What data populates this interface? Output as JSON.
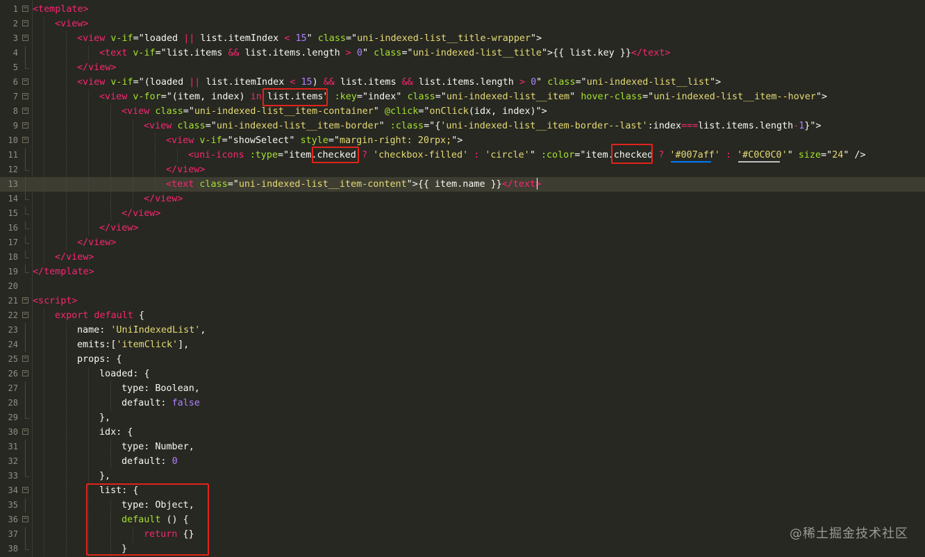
{
  "lines": [
    {
      "n": "1",
      "fold": "box",
      "indent": 0,
      "tokens": [
        [
          "t",
          "<template>"
        ]
      ]
    },
    {
      "n": "2",
      "fold": "box",
      "indent": 1,
      "tokens": [
        [
          "t",
          "<view>"
        ]
      ]
    },
    {
      "n": "3",
      "fold": "box",
      "indent": 2,
      "tokens": [
        [
          "t",
          "<view "
        ],
        [
          "a",
          "v-if"
        ],
        [
          "p",
          "=\""
        ],
        [
          "p",
          "loaded "
        ],
        [
          "t",
          "||"
        ],
        [
          "p",
          " list.itemIndex "
        ],
        [
          "t",
          "<"
        ],
        [
          "p",
          " "
        ],
        [
          "n",
          "15"
        ],
        [
          "p",
          "\" "
        ],
        [
          "a",
          "class"
        ],
        [
          "p",
          "=\""
        ],
        [
          "s",
          "uni-indexed-list__title-wrapper"
        ],
        [
          "p",
          "\">"
        ]
      ]
    },
    {
      "n": "4",
      "fold": "line",
      "indent": 3,
      "tokens": [
        [
          "t",
          "<text "
        ],
        [
          "a",
          "v-if"
        ],
        [
          "p",
          "=\"list.items "
        ],
        [
          "t",
          "&&"
        ],
        [
          "p",
          " list.items.length "
        ],
        [
          "t",
          ">"
        ],
        [
          "p",
          " "
        ],
        [
          "n",
          "0"
        ],
        [
          "p",
          "\" "
        ],
        [
          "a",
          "class"
        ],
        [
          "p",
          "=\""
        ],
        [
          "s",
          "uni-indexed-list__title"
        ],
        [
          "p",
          "\">{{ list.key }}"
        ],
        [
          "t",
          "</text>"
        ]
      ]
    },
    {
      "n": "5",
      "fold": "end",
      "indent": 2,
      "tokens": [
        [
          "t",
          "</view>"
        ]
      ]
    },
    {
      "n": "6",
      "fold": "box",
      "indent": 2,
      "tokens": [
        [
          "t",
          "<view "
        ],
        [
          "a",
          "v-if"
        ],
        [
          "p",
          "=\"(loaded "
        ],
        [
          "t",
          "||"
        ],
        [
          "p",
          " list.itemIndex "
        ],
        [
          "t",
          "<"
        ],
        [
          "p",
          " "
        ],
        [
          "n",
          "15"
        ],
        [
          "p",
          ") "
        ],
        [
          "t",
          "&&"
        ],
        [
          "p",
          " list.items "
        ],
        [
          "t",
          "&&"
        ],
        [
          "p",
          " list.items.length "
        ],
        [
          "t",
          ">"
        ],
        [
          "p",
          " "
        ],
        [
          "n",
          "0"
        ],
        [
          "p",
          "\" "
        ],
        [
          "a",
          "class"
        ],
        [
          "p",
          "=\""
        ],
        [
          "s",
          "uni-indexed-list__list"
        ],
        [
          "p",
          "\">"
        ]
      ]
    },
    {
      "n": "7",
      "fold": "box",
      "indent": 3,
      "tokens": [
        [
          "t",
          "<view "
        ],
        [
          "a",
          "v-for"
        ],
        [
          "p",
          "=\"(item, index) "
        ],
        [
          "t",
          "in"
        ],
        [
          "p",
          " list.items\" "
        ],
        [
          "a",
          ":key"
        ],
        [
          "p",
          "=\"index\" "
        ],
        [
          "a",
          "class"
        ],
        [
          "p",
          "=\""
        ],
        [
          "s",
          "uni-indexed-list__item"
        ],
        [
          "p",
          "\" "
        ],
        [
          "a",
          "hover-class"
        ],
        [
          "p",
          "=\""
        ],
        [
          "s",
          "uni-indexed-list__item--hover"
        ],
        [
          "p",
          "\">"
        ]
      ]
    },
    {
      "n": "8",
      "fold": "box",
      "indent": 4,
      "tokens": [
        [
          "t",
          "<view "
        ],
        [
          "a",
          "class"
        ],
        [
          "p",
          "=\""
        ],
        [
          "s",
          "uni-indexed-list__item-container"
        ],
        [
          "p",
          "\" "
        ],
        [
          "a",
          "@click"
        ],
        [
          "p",
          "=\""
        ],
        [
          "s",
          "onClick"
        ],
        [
          "p",
          "(idx, index)\">"
        ]
      ]
    },
    {
      "n": "9",
      "fold": "box",
      "indent": 5,
      "tokens": [
        [
          "t",
          "<view "
        ],
        [
          "a",
          "class"
        ],
        [
          "p",
          "=\""
        ],
        [
          "s",
          "uni-indexed-list__item-border"
        ],
        [
          "p",
          "\" "
        ],
        [
          "a",
          ":class"
        ],
        [
          "p",
          "=\"{"
        ],
        [
          "s",
          "'uni-indexed-list__item-border--last'"
        ],
        [
          "p",
          ":index"
        ],
        [
          "t",
          "==="
        ],
        [
          "p",
          "list.items.length"
        ],
        [
          "t",
          "-"
        ],
        [
          "n",
          "1"
        ],
        [
          "p",
          "}\">"
        ]
      ]
    },
    {
      "n": "10",
      "fold": "box",
      "indent": 6,
      "tokens": [
        [
          "t",
          "<view "
        ],
        [
          "a",
          "v-if"
        ],
        [
          "p",
          "=\"showSelect\" "
        ],
        [
          "a",
          "style"
        ],
        [
          "p",
          "=\""
        ],
        [
          "s",
          "margin-right: 20rpx;"
        ],
        [
          "p",
          "\">"
        ]
      ]
    },
    {
      "n": "11",
      "fold": "line",
      "indent": 7,
      "tokens": [
        [
          "t",
          "<uni-icons "
        ],
        [
          "a",
          ":type"
        ],
        [
          "p",
          "=\"item."
        ],
        [
          "p",
          "checked"
        ],
        [
          "p",
          " "
        ],
        [
          "t",
          "?"
        ],
        [
          "p",
          " "
        ],
        [
          "s",
          "'checkbox-filled'"
        ],
        [
          "p",
          " "
        ],
        [
          "t",
          ":"
        ],
        [
          "p",
          " "
        ],
        [
          "s",
          "'circle'"
        ],
        [
          "p",
          "\" "
        ],
        [
          "a",
          ":color"
        ],
        [
          "p",
          "=\"item."
        ],
        [
          "p",
          "checked"
        ],
        [
          "p",
          " "
        ],
        [
          "t",
          "?"
        ],
        [
          "p",
          " "
        ],
        [
          "s",
          "'#007aff'"
        ],
        [
          "p",
          " "
        ],
        [
          "t",
          ":"
        ],
        [
          "p",
          " "
        ],
        [
          "s",
          "'#C0C0C0'"
        ],
        [
          "p",
          "\" "
        ],
        [
          "a",
          "size"
        ],
        [
          "p",
          "=\""
        ],
        [
          "s",
          "24"
        ],
        [
          "p",
          "\" />"
        ]
      ]
    },
    {
      "n": "12",
      "fold": "end",
      "indent": 6,
      "tokens": [
        [
          "t",
          "</view>"
        ]
      ]
    },
    {
      "n": "13",
      "fold": "line",
      "indent": 6,
      "current": true,
      "tokens": [
        [
          "t",
          "<text "
        ],
        [
          "a",
          "class"
        ],
        [
          "p",
          "=\""
        ],
        [
          "s",
          "uni-indexed-list__item-content"
        ],
        [
          "p",
          "\">{{ item.name }}"
        ],
        [
          "t",
          "</text>"
        ]
      ]
    },
    {
      "n": "14",
      "fold": "end",
      "indent": 5,
      "tokens": [
        [
          "t",
          "</view>"
        ]
      ]
    },
    {
      "n": "15",
      "fold": "end",
      "indent": 4,
      "tokens": [
        [
          "t",
          "</view>"
        ]
      ]
    },
    {
      "n": "16",
      "fold": "end",
      "indent": 3,
      "tokens": [
        [
          "t",
          "</view>"
        ]
      ]
    },
    {
      "n": "17",
      "fold": "end",
      "indent": 2,
      "tokens": [
        [
          "t",
          "</view>"
        ]
      ]
    },
    {
      "n": "18",
      "fold": "end",
      "indent": 1,
      "tokens": [
        [
          "t",
          "</view>"
        ]
      ]
    },
    {
      "n": "19",
      "fold": "end",
      "indent": 0,
      "tokens": [
        [
          "t",
          "</template>"
        ]
      ]
    },
    {
      "n": "20",
      "fold": "none",
      "indent": 0,
      "tokens": []
    },
    {
      "n": "21",
      "fold": "box",
      "indent": 0,
      "tokens": [
        [
          "t",
          "<script>"
        ]
      ]
    },
    {
      "n": "22",
      "fold": "box",
      "indent": 1,
      "tokens": [
        [
          "t",
          "export default"
        ],
        [
          "p",
          " {"
        ]
      ]
    },
    {
      "n": "23",
      "fold": "line",
      "indent": 2,
      "tokens": [
        [
          "p",
          "name: "
        ],
        [
          "s",
          "'UniIndexedList'"
        ],
        [
          "p",
          ","
        ]
      ]
    },
    {
      "n": "24",
      "fold": "line",
      "indent": 2,
      "tokens": [
        [
          "p",
          "emits:["
        ],
        [
          "s",
          "'itemClick'"
        ],
        [
          "p",
          "],"
        ]
      ]
    },
    {
      "n": "25",
      "fold": "box",
      "indent": 2,
      "tokens": [
        [
          "p",
          "props: {"
        ]
      ]
    },
    {
      "n": "26",
      "fold": "box",
      "indent": 3,
      "tokens": [
        [
          "p",
          "loaded: {"
        ]
      ]
    },
    {
      "n": "27",
      "fold": "line",
      "indent": 4,
      "tokens": [
        [
          "p",
          "type: Boolean,"
        ]
      ]
    },
    {
      "n": "28",
      "fold": "line",
      "indent": 4,
      "tokens": [
        [
          "p",
          "default: "
        ],
        [
          "n",
          "false"
        ]
      ]
    },
    {
      "n": "29",
      "fold": "end",
      "indent": 3,
      "tokens": [
        [
          "p",
          "},"
        ]
      ]
    },
    {
      "n": "30",
      "fold": "box",
      "indent": 3,
      "tokens": [
        [
          "p",
          "idx: {"
        ]
      ]
    },
    {
      "n": "31",
      "fold": "line",
      "indent": 4,
      "tokens": [
        [
          "p",
          "type: Number,"
        ]
      ]
    },
    {
      "n": "32",
      "fold": "line",
      "indent": 4,
      "tokens": [
        [
          "p",
          "default: "
        ],
        [
          "n",
          "0"
        ]
      ]
    },
    {
      "n": "33",
      "fold": "end",
      "indent": 3,
      "tokens": [
        [
          "p",
          "},"
        ]
      ]
    },
    {
      "n": "34",
      "fold": "box",
      "indent": 3,
      "tokens": [
        [
          "p",
          "list: {"
        ]
      ]
    },
    {
      "n": "35",
      "fold": "line",
      "indent": 4,
      "tokens": [
        [
          "p",
          "type: Object,"
        ]
      ]
    },
    {
      "n": "36",
      "fold": "box",
      "indent": 4,
      "tokens": [
        [
          "a",
          "default"
        ],
        [
          "p",
          " () {"
        ]
      ]
    },
    {
      "n": "37",
      "fold": "line",
      "indent": 5,
      "tokens": [
        [
          "t",
          "return"
        ],
        [
          "p",
          " {}"
        ]
      ]
    },
    {
      "n": "38",
      "fold": "end",
      "indent": 4,
      "tokens": [
        [
          "p",
          "}"
        ]
      ]
    }
  ],
  "colors": {
    "background": "#272822",
    "highlight_box": "#e3231b",
    "underline_blue": "#007aff",
    "underline_silver": "#C0C0C0"
  },
  "watermark": "@稀土掘金技术社区"
}
